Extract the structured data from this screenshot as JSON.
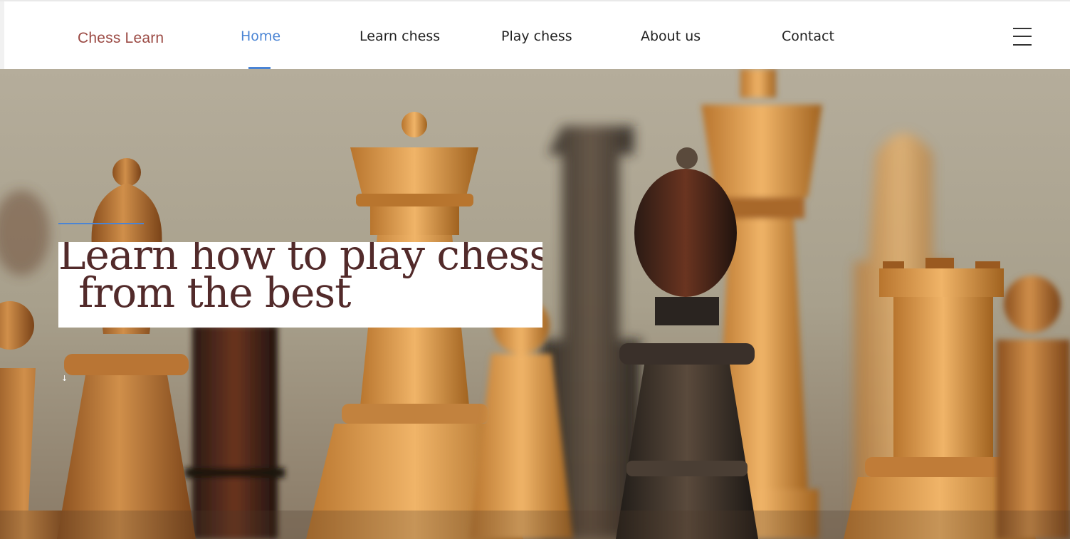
{
  "header": {
    "brand": "Chess Learn",
    "nav": [
      {
        "label": "Home",
        "active": true
      },
      {
        "label": "Learn chess",
        "active": false
      },
      {
        "label": "Play chess",
        "active": false
      },
      {
        "label": "About us",
        "active": false
      },
      {
        "label": "Contact",
        "active": false
      }
    ],
    "menu_icon": "hamburger-menu-icon"
  },
  "hero": {
    "image": "chess-pieces-photo",
    "headline_line1": "Learn how to play chess",
    "headline_line2": "from the best",
    "scroll_icon": "arrow-down-icon",
    "scroll_glyph": "↓"
  },
  "colors": {
    "brand": "#9b4a44",
    "accent": "#4a84d4",
    "headline": "#522a2a"
  }
}
